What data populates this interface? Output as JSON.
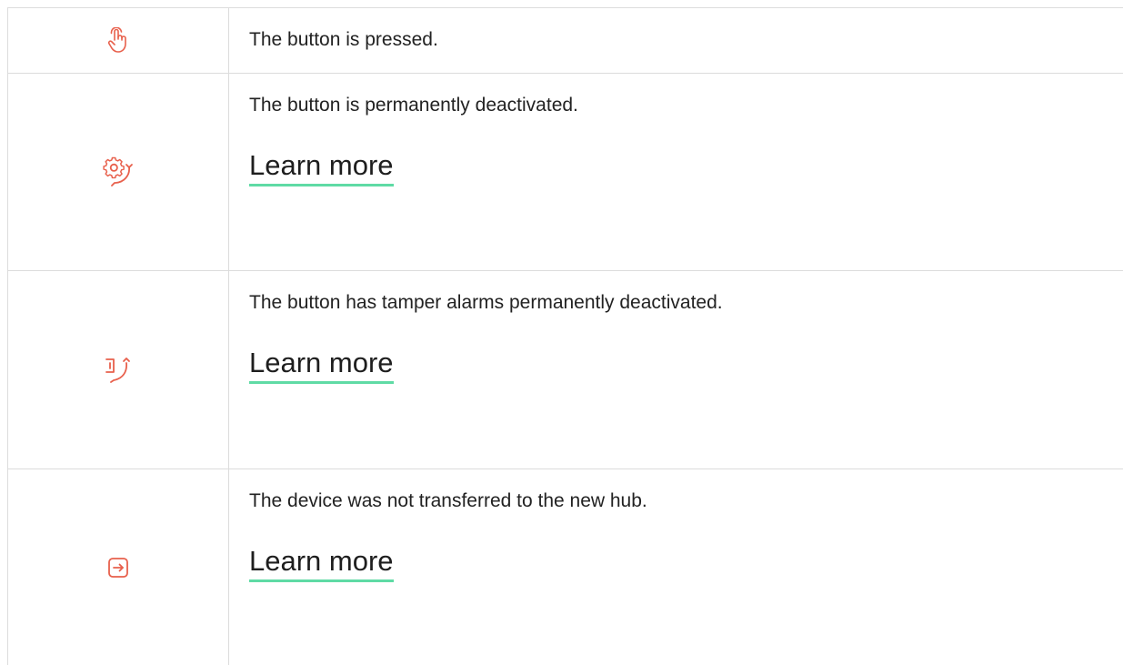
{
  "colors": {
    "icon": "#e8604c",
    "link_underline": "#5fdba5",
    "border": "#dcdcdc"
  },
  "rows": [
    {
      "icon": "hand-press-icon",
      "text": "The button is pressed.",
      "link": ""
    },
    {
      "icon": "gear-deactivated-icon",
      "text": "The button is permanently deactivated.",
      "link": "Learn more"
    },
    {
      "icon": "tamper-deactivated-icon",
      "text": "The button has tamper alarms permanently deactivated.",
      "link": "Learn more"
    },
    {
      "icon": "arrow-in-box-icon",
      "text": "The device was not transferred to the new hub.",
      "link": "Learn more"
    }
  ]
}
